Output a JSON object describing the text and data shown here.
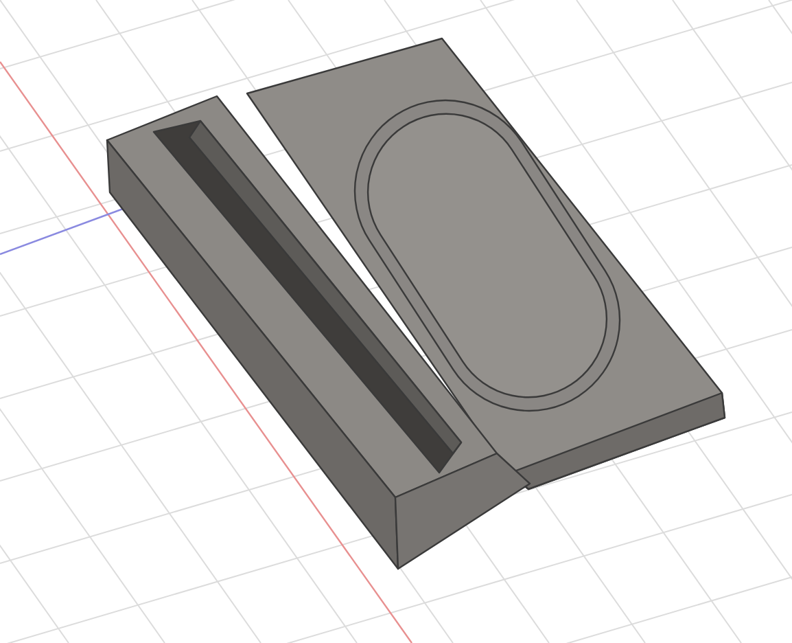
{
  "viewport": {
    "show_grid": true,
    "show_axes": true
  }
}
